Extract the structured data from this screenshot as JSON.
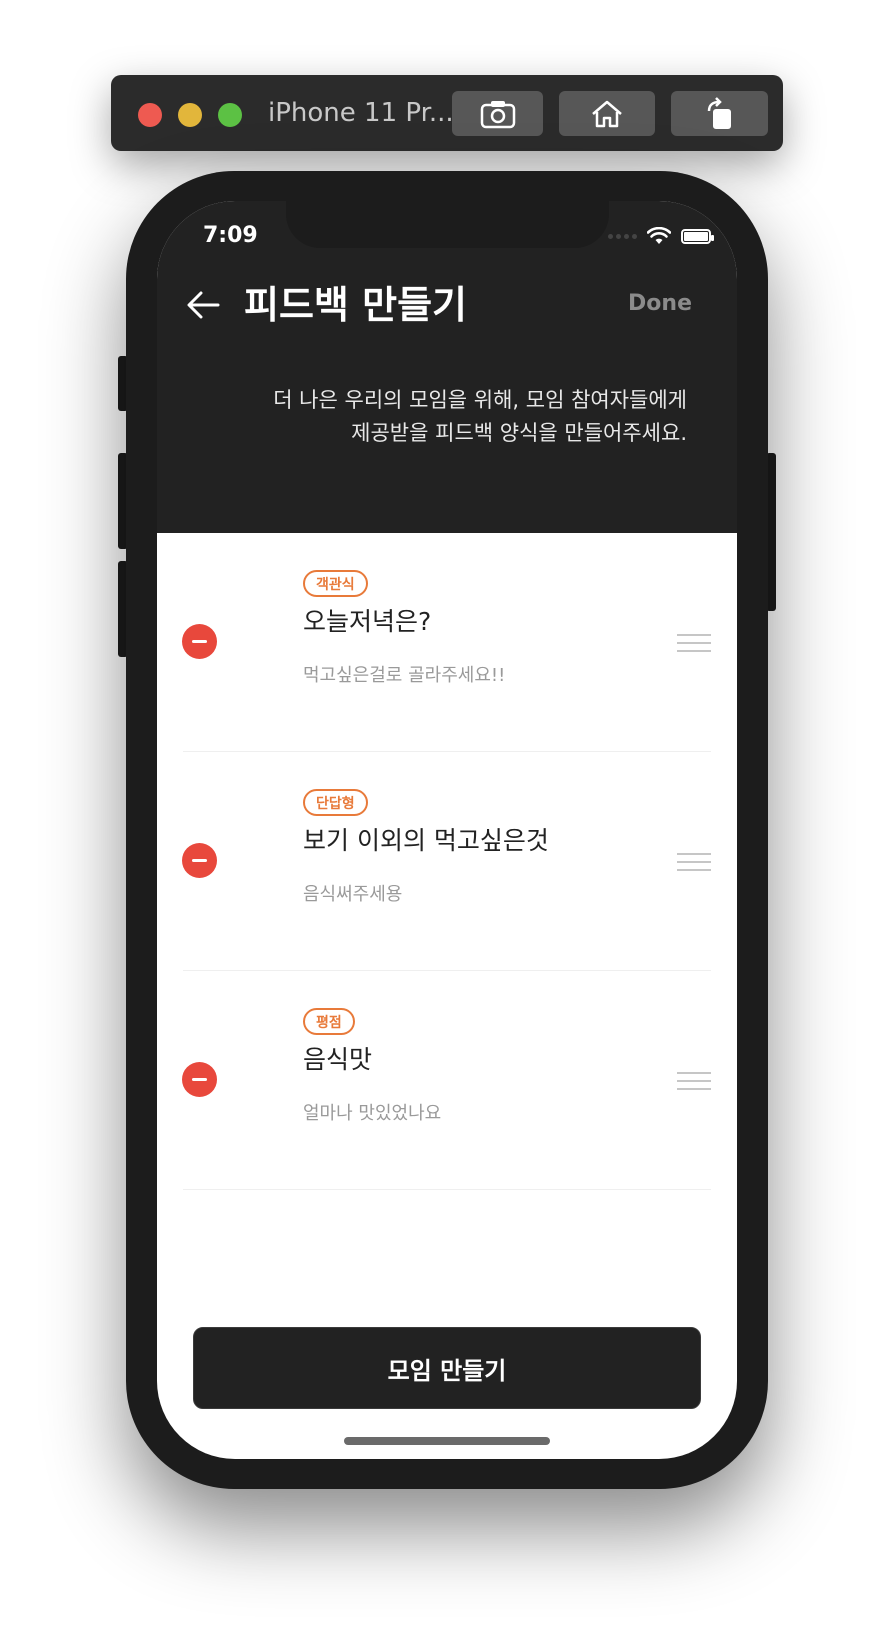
{
  "simulator": {
    "title": "iPhone 11 Pr..."
  },
  "status_bar": {
    "time": "7:09"
  },
  "header": {
    "title": "피드백 만들기",
    "done_label": "Done",
    "subtitle_line1": "더 나은 우리의 모임을 위해, 모임 참여자들에게",
    "subtitle_line2": "제공받을 피드백 양식을 만들어주세요."
  },
  "items": [
    {
      "type": "객관식",
      "title": "오늘저녁은?",
      "description": "먹고싶은걸로 골라주세요!!"
    },
    {
      "type": "단답형",
      "title": "보기 이외의 먹고싶은것",
      "description": "음식써주세용"
    },
    {
      "type": "평점",
      "title": "음식맛",
      "description": "얼마나 맛있었나요"
    }
  ],
  "footer": {
    "create_label": "모임 만들기"
  },
  "colors": {
    "accent_orange": "#e87a3a",
    "remove_red": "#e8483c",
    "header_dark": "#222222"
  }
}
